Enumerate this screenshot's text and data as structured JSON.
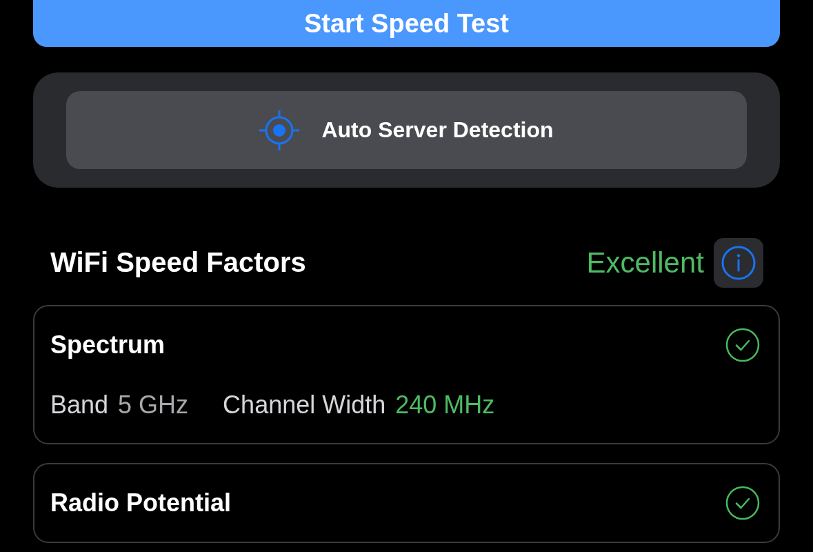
{
  "start_button": {
    "label": "Start Speed Test"
  },
  "server_panel": {
    "button": {
      "label": "Auto Server Detection"
    }
  },
  "speed_factors": {
    "title": "WiFi Speed Factors",
    "rating": "Excellent",
    "cards": [
      {
        "title": "Spectrum",
        "ok": true,
        "fields": [
          {
            "label": "Band",
            "value": "5 GHz",
            "highlight": false
          },
          {
            "label": "Channel Width",
            "value": "240 MHz",
            "highlight": true
          }
        ]
      },
      {
        "title": "Radio Potential",
        "ok": true
      }
    ]
  }
}
